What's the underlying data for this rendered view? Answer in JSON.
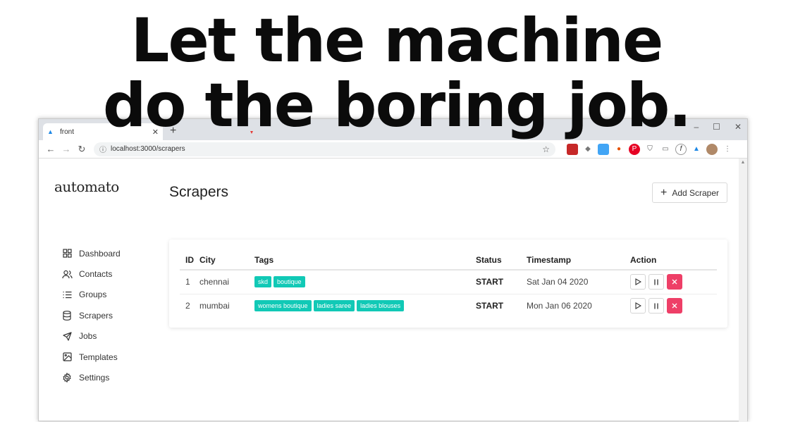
{
  "hero": {
    "line1": "Let the machine",
    "line2": "do the boring job."
  },
  "browser": {
    "tab_title": "front",
    "tab_close": "✕",
    "new_tab": "+",
    "win_min": "–",
    "win_max": "☐",
    "win_close": "✕",
    "url": "localhost:3000/scrapers"
  },
  "app": {
    "logo": "automato",
    "menu": [
      {
        "label": "Dashboard",
        "icon": "grid-icon"
      },
      {
        "label": "Contacts",
        "icon": "users-icon"
      },
      {
        "label": "Groups",
        "icon": "list-icon"
      },
      {
        "label": "Scrapers",
        "icon": "database-icon"
      },
      {
        "label": "Jobs",
        "icon": "send-icon"
      },
      {
        "label": "Templates",
        "icon": "image-icon"
      },
      {
        "label": "Settings",
        "icon": "gear-icon"
      }
    ],
    "page_title": "Scrapers",
    "add_button": "Add Scraper",
    "table": {
      "headers": [
        "ID",
        "City",
        "Tags",
        "Status",
        "Timestamp",
        "Action"
      ],
      "rows": [
        {
          "id": "1",
          "city": "chennai",
          "tags": [
            "skd",
            "boutique"
          ],
          "status": "START",
          "timestamp": "Sat Jan 04 2020"
        },
        {
          "id": "2",
          "city": "mumbai",
          "tags": [
            "womens boutique",
            "ladies saree",
            "ladies blouses"
          ],
          "status": "START",
          "timestamp": "Mon Jan 06 2020"
        }
      ]
    }
  }
}
